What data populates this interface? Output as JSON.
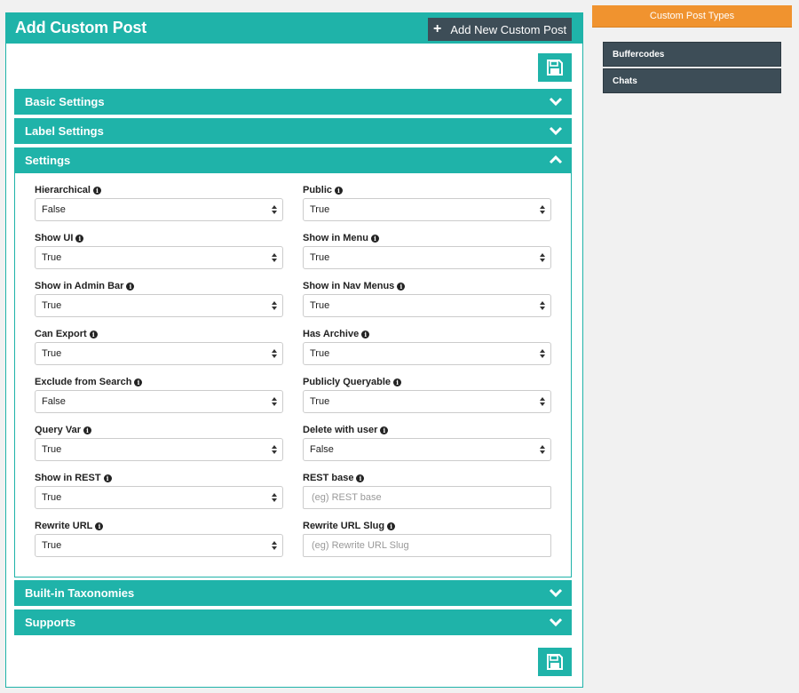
{
  "page": {
    "title": "Add Custom Post",
    "add_new_label": "Add New Custom Post",
    "add_new_icon": "plus-icon",
    "save_icon": "floppy-disk-icon",
    "accent_color": "#1fb3a9",
    "dark_color": "#3d4d57"
  },
  "sections": {
    "basic": {
      "label": "Basic Settings",
      "state": "collapsed"
    },
    "label": {
      "label": "Label Settings",
      "state": "collapsed"
    },
    "settings": {
      "label": "Settings",
      "state": "expanded"
    },
    "taxonomies": {
      "label": "Built-in Taxonomies",
      "state": "collapsed"
    },
    "supports": {
      "label": "Supports",
      "state": "collapsed"
    }
  },
  "fields": {
    "hierarchical": {
      "label": "Hierarchical",
      "value": "False"
    },
    "public": {
      "label": "Public",
      "value": "True"
    },
    "show_ui": {
      "label": "Show UI",
      "value": "True"
    },
    "show_in_menu": {
      "label": "Show in Menu",
      "value": "True"
    },
    "show_in_admin_bar": {
      "label": "Show in Admin Bar",
      "value": "True"
    },
    "show_in_nav_menus": {
      "label": "Show in Nav Menus",
      "value": "True"
    },
    "can_export": {
      "label": "Can Export",
      "value": "True"
    },
    "has_archive": {
      "label": "Has Archive",
      "value": "True"
    },
    "exclude_from_search": {
      "label": "Exclude from Search",
      "value": "False"
    },
    "publicly_queryable": {
      "label": "Publicly Queryable",
      "value": "True"
    },
    "query_var": {
      "label": "Query Var",
      "value": "True"
    },
    "delete_with_user": {
      "label": "Delete with user",
      "value": "False"
    },
    "show_in_rest": {
      "label": "Show in REST",
      "value": "True"
    },
    "rest_base": {
      "label": "REST base",
      "placeholder": "(eg) REST base"
    },
    "rewrite_url": {
      "label": "Rewrite URL",
      "value": "True"
    },
    "rewrite_url_slug": {
      "label": "Rewrite URL Slug",
      "placeholder": "(eg) Rewrite URL Slug"
    }
  },
  "sidebar": {
    "header": "Custom Post Types",
    "header_color": "#f0932f",
    "items": [
      {
        "label": "Buffercodes"
      },
      {
        "label": "Chats"
      }
    ]
  }
}
